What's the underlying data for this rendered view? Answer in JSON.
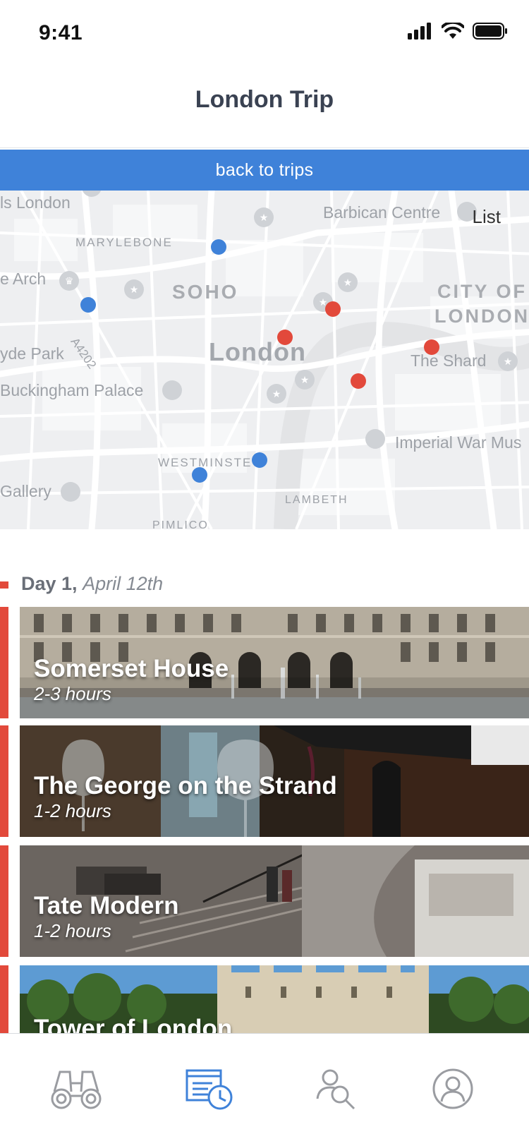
{
  "status_bar": {
    "time": "9:41"
  },
  "header": {
    "title": "London Trip"
  },
  "back_bar": {
    "label": "back to trips"
  },
  "map": {
    "list_label": "List",
    "labels": {
      "marylebone": "MARYLEBONE",
      "soho": "SOHO",
      "city_of_london_1": "CITY OF",
      "city_of_london_2": "LONDON",
      "london": "London",
      "london_left": "ls London",
      "barbican": "Barbican Centre",
      "marble_arch": "e Arch",
      "hyde_park": "yde Park",
      "a4202": "A4202",
      "buckingham": "Buckingham Palace",
      "the_shard": "The Shard",
      "westminster": "WESTMINSTE",
      "imperial": "Imperial War Mus",
      "lambeth": "LAMBETH",
      "gallery": "Gallery",
      "pimlico": "PIMLICO"
    },
    "pin_colors": {
      "blue": "#3f82d9",
      "red": "#e2493b"
    }
  },
  "day": {
    "label": "Day 1,",
    "date": "April 12th"
  },
  "items": [
    {
      "title": "Somerset House",
      "duration": "2-3 hours"
    },
    {
      "title": "The George on the Strand",
      "duration": "1-2 hours"
    },
    {
      "title": "Tate Modern",
      "duration": "1-2 hours"
    },
    {
      "title": "Tower of London",
      "duration": ""
    }
  ],
  "tabs": [
    {
      "icon": "binoculars-icon"
    },
    {
      "icon": "itinerary-clock-icon",
      "active": true
    },
    {
      "icon": "search-user-icon"
    },
    {
      "icon": "profile-icon"
    }
  ],
  "colors": {
    "accent": "#3f82d9",
    "route": "#e2493b",
    "title": "#3a4252"
  }
}
